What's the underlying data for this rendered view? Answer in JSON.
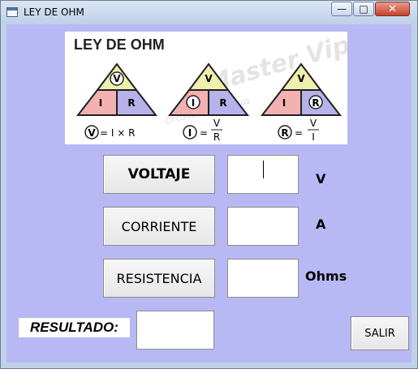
{
  "window": {
    "title": "LEY DE OHM",
    "minimize_symbol": "—",
    "maximize_symbol": "□",
    "close_symbol": "✕"
  },
  "diagram": {
    "title": "LEY DE OHM",
    "watermark": "Master Vip",
    "watermark_sub": "Circuitos Electrónicos",
    "triangles": [
      {
        "top": "V",
        "left": "I",
        "right": "R",
        "highlight": "V"
      },
      {
        "top": "V",
        "left": "I",
        "right": "R",
        "highlight": "I"
      },
      {
        "top": "V",
        "left": "I",
        "right": "R",
        "highlight": "R"
      }
    ],
    "formulas": [
      {
        "var": "V",
        "eq": "= I × R"
      },
      {
        "var": "I",
        "eq": "=",
        "num": "V",
        "den": "R"
      },
      {
        "var": "R",
        "eq": "=",
        "num": "V",
        "den": "I"
      }
    ],
    "colors": {
      "top": "#efefae",
      "left": "#f4b1b1",
      "right": "#b7b2ea",
      "outline": "#202020"
    }
  },
  "buttons": {
    "voltage": "VOLTAJE",
    "current": "CORRIENTE",
    "resistance": "RESISTENCIA",
    "exit": "SALIR"
  },
  "units": {
    "voltage": "V",
    "current": "A",
    "resistance": "Ohms"
  },
  "result_label": "RESULTADO:",
  "inputs": {
    "voltage": "",
    "current": "",
    "resistance": "",
    "result": ""
  }
}
